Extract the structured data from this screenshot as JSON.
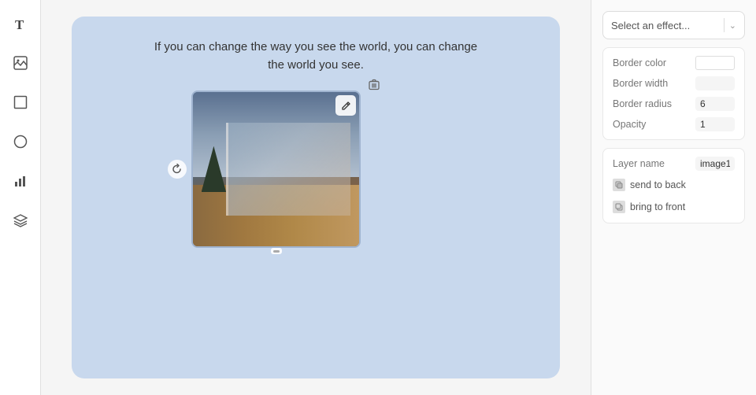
{
  "toolbar": {
    "icons": [
      {
        "name": "text-tool",
        "symbol": "T"
      },
      {
        "name": "image-tool",
        "symbol": "🖼"
      },
      {
        "name": "rectangle-tool",
        "symbol": "□"
      },
      {
        "name": "ellipse-tool",
        "symbol": "○"
      },
      {
        "name": "chart-tool",
        "symbol": "📊"
      },
      {
        "name": "layers-tool",
        "symbol": "⊞"
      }
    ]
  },
  "canvas": {
    "text": "If you can change the way you see the world, you can change\nthe world you see."
  },
  "rightPanel": {
    "effectPlaceholder": "Select an effect...",
    "properties": {
      "borderColorLabel": "Border color",
      "borderWidthLabel": "Border width",
      "borderRadiusLabel": "Border radius",
      "borderRadiusValue": "6",
      "opacityLabel": "Opacity",
      "opacityValue": "1"
    },
    "layer": {
      "nameLabel": "Layer name",
      "nameValue": "image1",
      "sendToBackLabel": "send to back",
      "bringToFrontLabel": "bring to front"
    }
  }
}
